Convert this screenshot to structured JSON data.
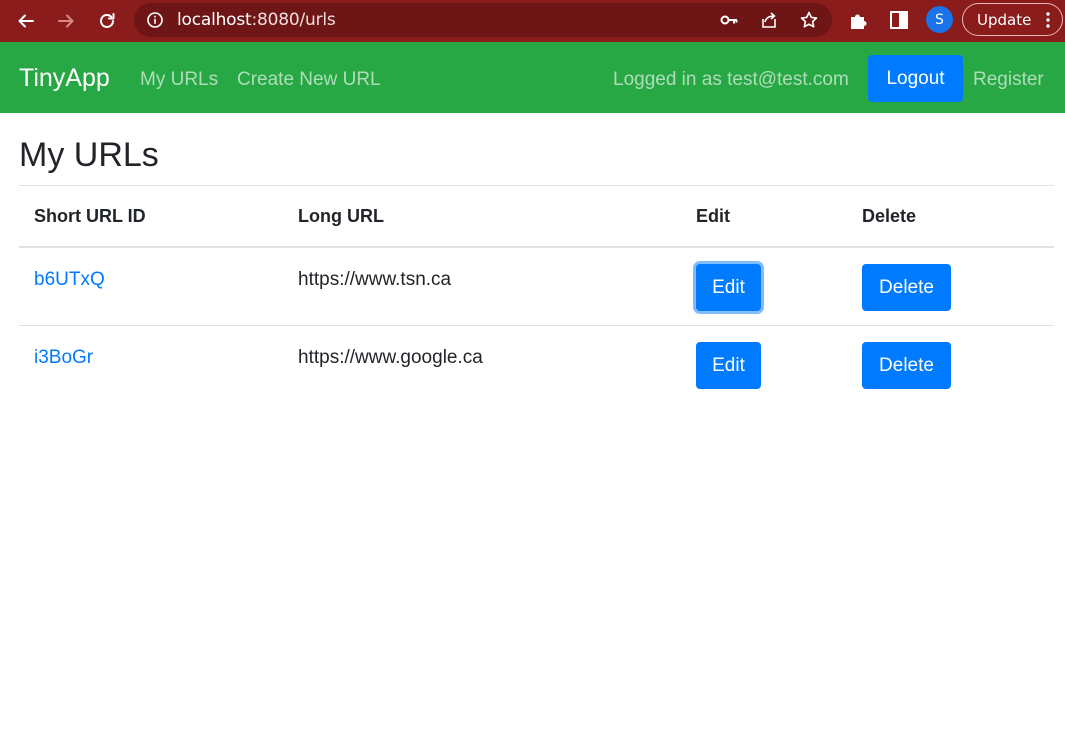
{
  "browser": {
    "url_host": "localhost",
    "url_rest": ":8080/urls",
    "avatar_letter": "S",
    "update_label": "Update",
    "icons": [
      "back-arrow-icon",
      "forward-arrow-icon",
      "reload-icon",
      "info-icon",
      "key-icon",
      "share-icon",
      "star-icon",
      "extension-puzzle-icon",
      "side-panel-icon",
      "kebab-menu-icon"
    ]
  },
  "navbar": {
    "brand": "TinyApp",
    "links": [
      "My URLs",
      "Create New URL"
    ],
    "logged_in_text": "Logged in as test@test.com",
    "logout_label": "Logout",
    "register_label": "Register",
    "background": "#28a745"
  },
  "main": {
    "title": "My URLs",
    "columns": [
      "Short URL ID",
      "Long URL",
      "Edit",
      "Delete"
    ],
    "rows": [
      {
        "short_id": "b6UTxQ",
        "long_url": "https://www.tsn.ca",
        "edit_label": "Edit",
        "delete_label": "Delete",
        "edit_focused": true
      },
      {
        "short_id": "i3BoGr",
        "long_url": "https://www.google.ca",
        "edit_label": "Edit",
        "delete_label": "Delete",
        "edit_focused": false
      }
    ],
    "accent": "#007bff"
  }
}
